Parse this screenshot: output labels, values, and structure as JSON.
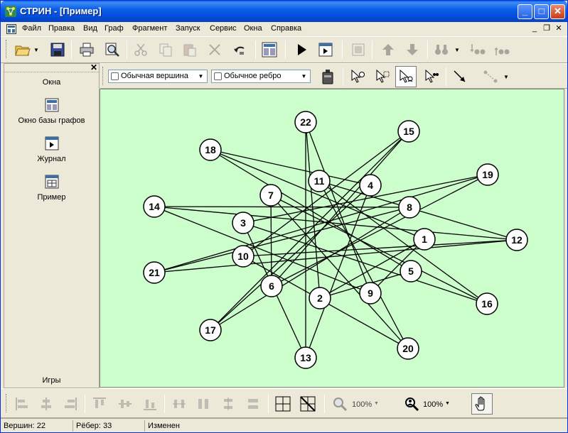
{
  "window": {
    "title": "СТРИН - [Пример]",
    "minimize": "_",
    "maximize": "□",
    "close": "✕"
  },
  "menu": {
    "items": [
      "Файл",
      "Правка",
      "Вид",
      "Граф",
      "Фрагмент",
      "Запуск",
      "Сервис",
      "Окна",
      "Справка"
    ],
    "mdi_minimize": "_",
    "mdi_restore": "❐",
    "mdi_close": "✕"
  },
  "toolbar2": {
    "vertex_type": "Обычная вершина",
    "edge_type": "Обычное ребро"
  },
  "leftpanel": {
    "section_windows": "Окна",
    "items": [
      "Окно базы графов",
      "Журнал",
      "Пример"
    ],
    "section_games": "Игры",
    "close": "✕"
  },
  "bottom_toolbar": {
    "zoom1": "100%",
    "zoom2": "100%"
  },
  "status": {
    "vertices": "Вершин: 22",
    "edges": "Рёбер: 33",
    "state": "Изменен"
  },
  "colors": {
    "canvas_bg": "#ccffcc",
    "titlebar": "#0550dd",
    "node_fill": "#ffffff",
    "node_stroke": "#000000"
  },
  "graph": {
    "nodes": [
      {
        "id": "1"
      },
      {
        "id": "2"
      },
      {
        "id": "3"
      },
      {
        "id": "4"
      },
      {
        "id": "5"
      },
      {
        "id": "6"
      },
      {
        "id": "7"
      },
      {
        "id": "8"
      },
      {
        "id": "9"
      },
      {
        "id": "10"
      },
      {
        "id": "11"
      },
      {
        "id": "12"
      },
      {
        "id": "13"
      },
      {
        "id": "14"
      },
      {
        "id": "15"
      },
      {
        "id": "16"
      },
      {
        "id": "17"
      },
      {
        "id": "18"
      },
      {
        "id": "19"
      },
      {
        "id": "20"
      },
      {
        "id": "21"
      },
      {
        "id": "22"
      }
    ],
    "edges": [
      [
        "22",
        "13"
      ],
      [
        "22",
        "2"
      ],
      [
        "22",
        "9"
      ],
      [
        "15",
        "17"
      ],
      [
        "15",
        "6"
      ],
      [
        "15",
        "10"
      ],
      [
        "18",
        "1"
      ],
      [
        "18",
        "4"
      ],
      [
        "18",
        "5"
      ],
      [
        "19",
        "21"
      ],
      [
        "19",
        "3"
      ],
      [
        "19",
        "6"
      ],
      [
        "14",
        "12"
      ],
      [
        "14",
        "8"
      ],
      [
        "14",
        "9"
      ],
      [
        "12",
        "21"
      ],
      [
        "12",
        "11"
      ],
      [
        "12",
        "10"
      ],
      [
        "21",
        "8"
      ],
      [
        "16",
        "7"
      ],
      [
        "16",
        "3"
      ],
      [
        "16",
        "11"
      ],
      [
        "17",
        "4"
      ],
      [
        "17",
        "8"
      ],
      [
        "20",
        "7"
      ],
      [
        "20",
        "11"
      ],
      [
        "20",
        "10"
      ],
      [
        "13",
        "4"
      ],
      [
        "13",
        "3"
      ],
      [
        "7",
        "6"
      ],
      [
        "1",
        "2"
      ],
      [
        "5",
        "2"
      ],
      [
        "9",
        "1"
      ]
    ]
  }
}
